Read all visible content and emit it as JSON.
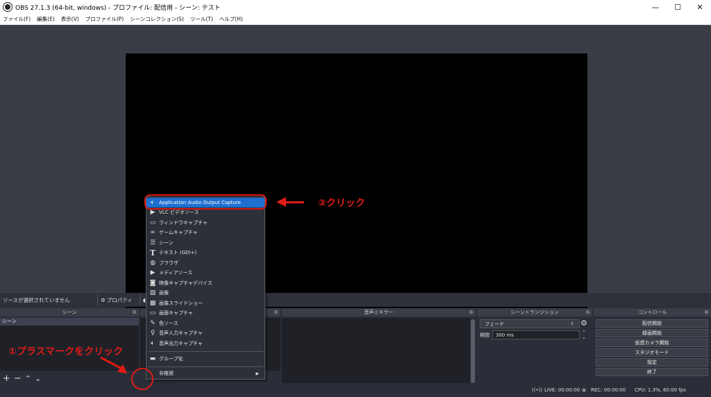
{
  "window": {
    "title": "OBS 27.1.3 (64-bit, windows) - プロファイル: 配信用 - シーン: テスト",
    "minimize": "—",
    "maximize": "☐",
    "close": "✕"
  },
  "menu": [
    "ファイル(F)",
    "編集(E)",
    "表示(V)",
    "プロファイル(P)",
    "シーンコレクション(S)",
    "ツール(T)",
    "ヘルプ(H)"
  ],
  "source_toolbar": {
    "no_selection": "ソースが選択されていません",
    "properties": "プロパティ",
    "filters": "フィ"
  },
  "docks": {
    "scenes": {
      "title": "シーン",
      "items": [
        "シーン"
      ]
    },
    "mixer": {
      "title": "音声ミキサー"
    },
    "transitions": {
      "title": "シーントランジション",
      "selected": "フェード",
      "duration_label": "期間",
      "duration_value": "300 ms"
    },
    "controls": {
      "title": "コントロール",
      "buttons": [
        "配信開始",
        "録画開始",
        "仮想カメラ開始",
        "スタジオモード",
        "設定",
        "終了"
      ]
    }
  },
  "context_menu": {
    "items": [
      {
        "label": "Application Audio Output Capture",
        "icon": "speaker-icon"
      },
      {
        "label": "VLC ビデオソース",
        "icon": "play-icon"
      },
      {
        "label": "ウィンドウキャプチャ",
        "icon": "window-icon"
      },
      {
        "label": "ゲームキャプチャ",
        "icon": "gamepad-icon"
      },
      {
        "label": "シーン",
        "icon": "list-icon"
      },
      {
        "label": "テキスト (GDI+)",
        "icon": "text-icon"
      },
      {
        "label": "ブラウザ",
        "icon": "globe-icon"
      },
      {
        "label": "メディアソース",
        "icon": "play-icon"
      },
      {
        "label": "映像キャプチャデバイス",
        "icon": "camera-icon"
      },
      {
        "label": "画像",
        "icon": "image-icon"
      },
      {
        "label": "画像スライドショー",
        "icon": "slideshow-icon"
      },
      {
        "label": "画面キャプチャ",
        "icon": "monitor-icon"
      },
      {
        "label": "色ソース",
        "icon": "brush-icon"
      },
      {
        "label": "音声入力キャプチャ",
        "icon": "mic-icon"
      },
      {
        "label": "音声出力キャプチャ",
        "icon": "speaker-icon"
      }
    ],
    "group": {
      "label": "グループ化",
      "icon": "folder-icon"
    },
    "deprecated": {
      "label": "非推奨"
    }
  },
  "annotations": {
    "step2": "②クリック",
    "step1": "①プラスマークをクリック"
  },
  "status": {
    "live": "LIVE: 00:00:00",
    "rec": "REC: 00:00:00",
    "cpu": "CPU: 1.3%, 60.00 fps"
  },
  "colors": {
    "highlight": "#1e6fd0",
    "annotation": "#e01b16"
  }
}
